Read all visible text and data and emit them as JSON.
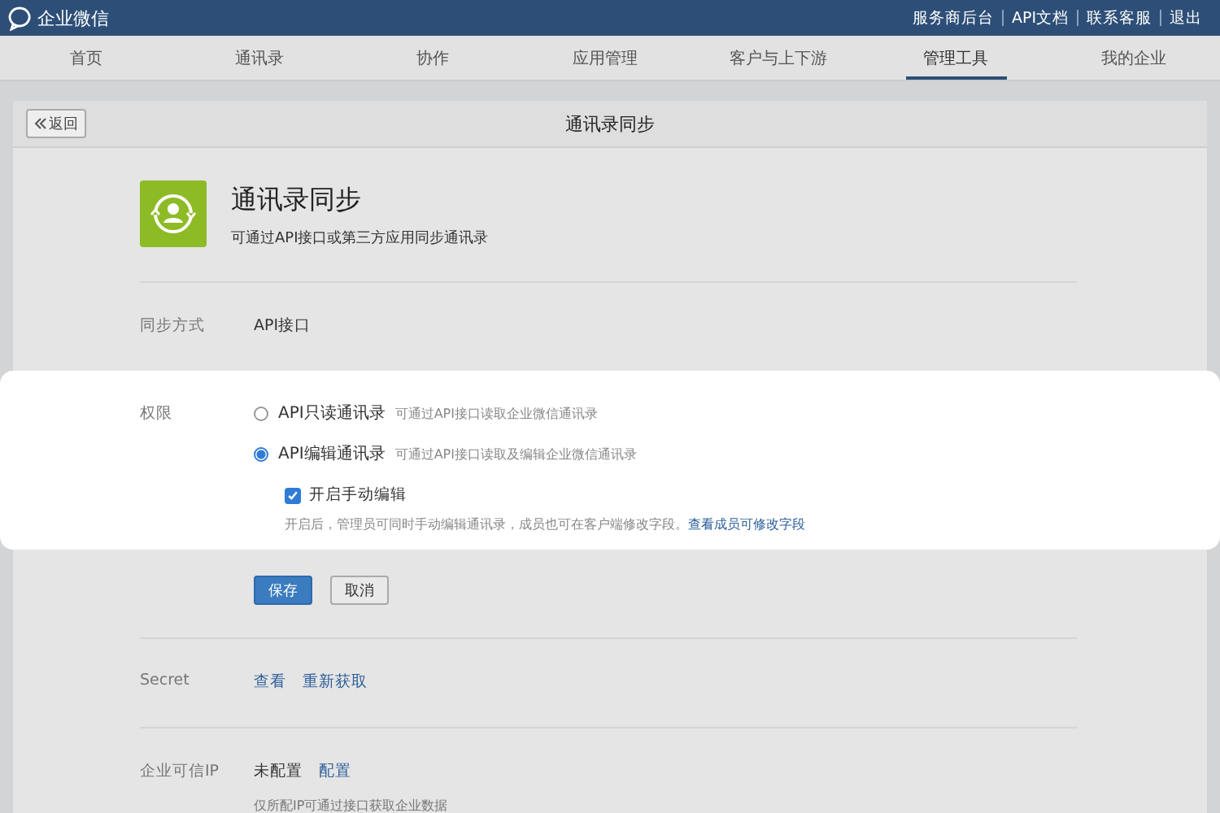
{
  "topbar": {
    "logo": "企业微信",
    "links": [
      "服务商后台",
      "API文档",
      "联系客服",
      "退出"
    ]
  },
  "nav": [
    {
      "label": "首页",
      "selected": false
    },
    {
      "label": "通讯录",
      "selected": false
    },
    {
      "label": "协作",
      "selected": false
    },
    {
      "label": "应用管理",
      "selected": false
    },
    {
      "label": "客户与上下游",
      "selected": false
    },
    {
      "label": "管理工具",
      "selected": true
    },
    {
      "label": "我的企业",
      "selected": false
    }
  ],
  "panel": {
    "back": "返回",
    "title": "通讯录同步"
  },
  "app": {
    "name": "通讯录同步",
    "description": "可通过API接口或第三方应用同步通讯录"
  },
  "sync_mode": {
    "label": "同步方式",
    "value": "API接口"
  },
  "permission": {
    "label": "权限",
    "options": [
      {
        "label": "API只读通讯录",
        "hint": "可通过API接口读取企业微信通讯录",
        "selected": false
      },
      {
        "label": "API编辑通讯录",
        "hint": "可通过API接口读取及编辑企业微信通讯录",
        "selected": true
      }
    ],
    "manual_edit": {
      "label": "开启手动编辑",
      "checked": true,
      "note": "开启后，管理员可同时手动编辑通讯录，成员也可在客户端修改字段。",
      "link": "查看成员可修改字段"
    }
  },
  "buttons": {
    "save": "保存",
    "cancel": "取消"
  },
  "secret": {
    "label": "Secret",
    "links": [
      "查看",
      "重新获取"
    ]
  },
  "trusted_ip": {
    "label": "企业可信IP",
    "value": "未配置",
    "link": "配置",
    "note": "仅所配IP可通过接口获取企业数据"
  }
}
